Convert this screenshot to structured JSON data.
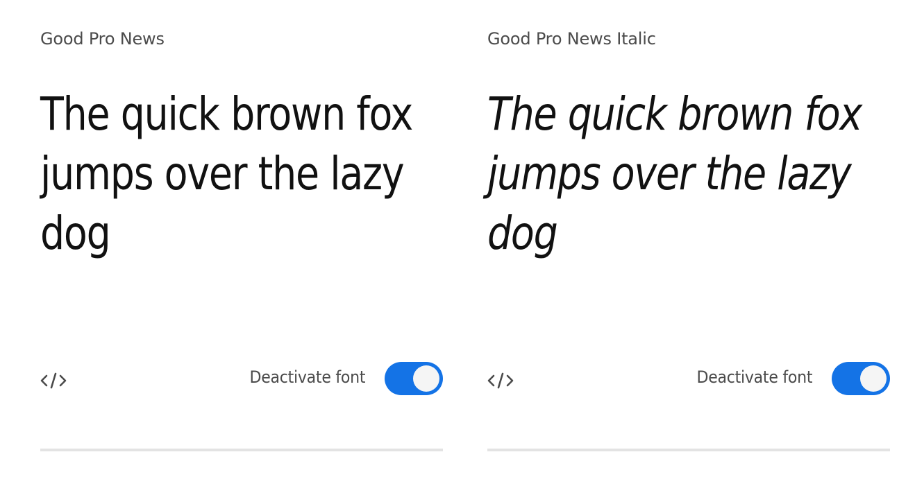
{
  "cards": [
    {
      "font_name": "Good Pro News",
      "sample_text": "The quick brown fox jumps over the lazy dog",
      "embed_icon": "code-icon",
      "toggle_label": "Deactivate font",
      "toggle_on": true
    },
    {
      "font_name": "Good Pro News Italic",
      "sample_text": "The quick brown fox jumps over the lazy dog",
      "embed_icon": "code-icon",
      "toggle_label": "Deactivate font",
      "toggle_on": true
    }
  ],
  "colors": {
    "accent": "#1473e6",
    "divider": "#e3e3e3",
    "label_text": "#4b4b4b",
    "sample_text": "#111111"
  }
}
